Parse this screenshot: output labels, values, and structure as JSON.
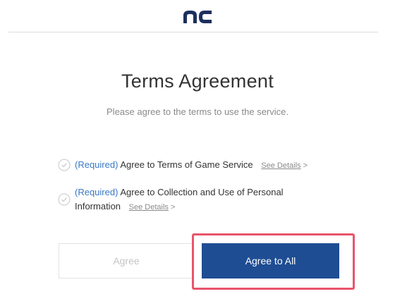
{
  "header": {
    "logo_text": "nc"
  },
  "main": {
    "title": "Terms Agreement",
    "subtitle": "Please agree to the terms to use the service."
  },
  "terms": [
    {
      "required_label": "(Required)",
      "text": "Agree to Terms of Game Service",
      "details_label": "See Details",
      "chevron": ">"
    },
    {
      "required_label": "(Required)",
      "text": "Agree to Collection and Use of Personal Information",
      "details_label": "See Details",
      "chevron": ">"
    }
  ],
  "buttons": {
    "agree_label": "Agree",
    "agree_all_label": "Agree to All"
  },
  "colors": {
    "required_blue": "#3a78c2",
    "primary_button": "#1e4d93",
    "highlight_red": "#e8556b"
  }
}
